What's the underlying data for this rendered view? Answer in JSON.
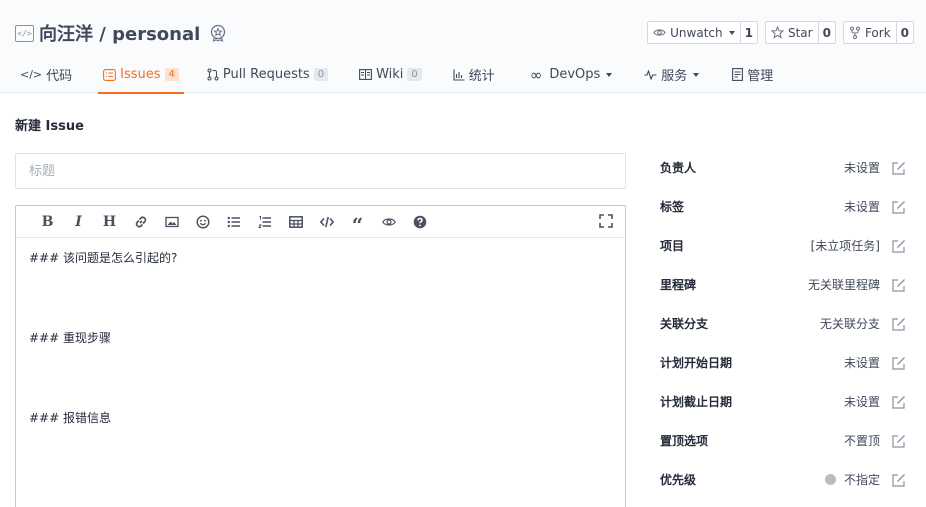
{
  "repo": {
    "title": "向汪洋 / personal"
  },
  "actions": {
    "watch": {
      "label": "Unwatch",
      "count": "1"
    },
    "star": {
      "label": "Star",
      "count": "0"
    },
    "fork": {
      "label": "Fork",
      "count": "0"
    }
  },
  "tabs": [
    {
      "label": "代码",
      "icon": "code-icon"
    },
    {
      "label": "Issues",
      "count": "4",
      "icon": "issue-icon",
      "active": true
    },
    {
      "label": "Pull Requests",
      "count": "0",
      "icon": "pull-request-icon"
    },
    {
      "label": "Wiki",
      "count": "0",
      "icon": "book-icon"
    },
    {
      "label": "统计",
      "icon": "chart-icon"
    },
    {
      "label": "DevOps",
      "icon": "infinity-icon"
    },
    {
      "label": "服务",
      "icon": "pulse-icon"
    },
    {
      "label": "管理",
      "icon": "document-icon"
    }
  ],
  "page": {
    "title": "新建 Issue",
    "title_placeholder": "标题"
  },
  "editor": {
    "lines": [
      "### 该问题是怎么引起的?",
      "### 重现步骤",
      "### 报错信息"
    ]
  },
  "sidebar": [
    {
      "label": "负责人",
      "value": "未设置"
    },
    {
      "label": "标签",
      "value": "未设置"
    },
    {
      "label": "项目",
      "value": "[未立项任务]"
    },
    {
      "label": "里程碑",
      "value": "无关联里程碑"
    },
    {
      "label": "关联分支",
      "value": "无关联分支"
    },
    {
      "label": "计划开始日期",
      "value": "未设置"
    },
    {
      "label": "计划截止日期",
      "value": "未设置"
    },
    {
      "label": "置顶选项",
      "value": "不置顶"
    },
    {
      "label": "优先级",
      "value": "不指定",
      "dot_color": "#b8bcc5"
    }
  ],
  "colors": {
    "accent": "#f26f21",
    "text": "#40485b",
    "border": "#d5d8df"
  }
}
